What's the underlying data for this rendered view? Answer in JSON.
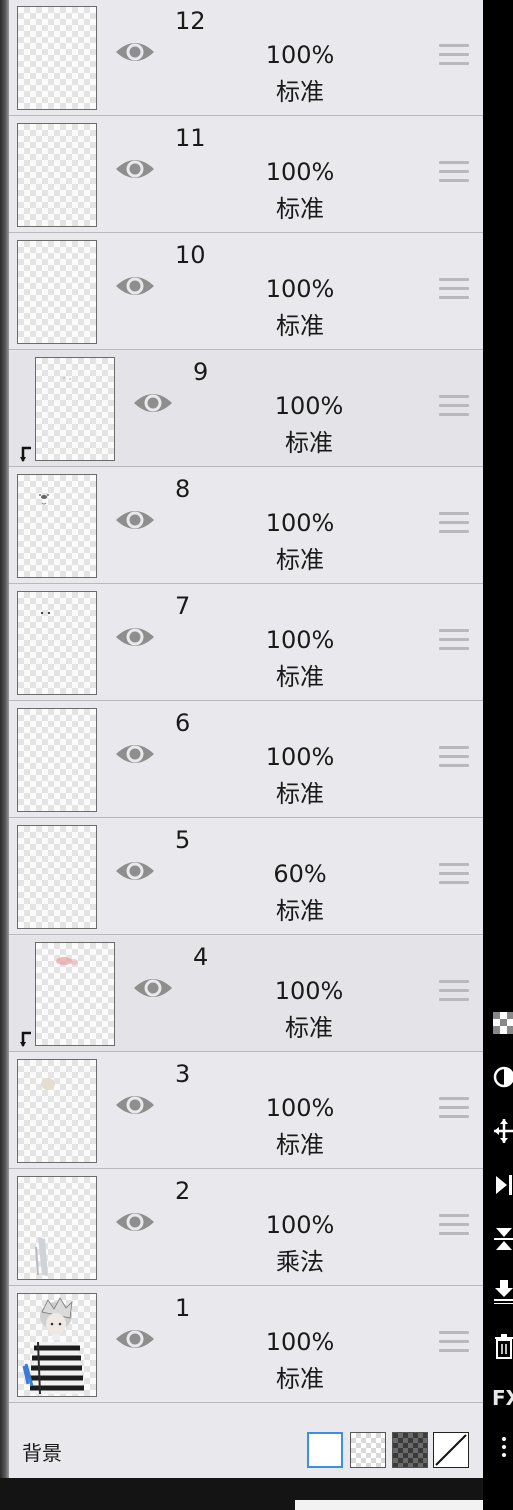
{
  "layers": [
    {
      "number": "12",
      "opacity": "100%",
      "blend": "标准",
      "clipped": false,
      "thumb": "empty"
    },
    {
      "number": "11",
      "opacity": "100%",
      "blend": "标准",
      "clipped": false,
      "thumb": "empty"
    },
    {
      "number": "10",
      "opacity": "100%",
      "blend": "标准",
      "clipped": false,
      "thumb": "empty"
    },
    {
      "number": "9",
      "opacity": "100%",
      "blend": "标准",
      "clipped": true,
      "thumb": "faint-dots"
    },
    {
      "number": "8",
      "opacity": "100%",
      "blend": "标准",
      "clipped": false,
      "thumb": "face-marks"
    },
    {
      "number": "7",
      "opacity": "100%",
      "blend": "标准",
      "clipped": false,
      "thumb": "eye-dots"
    },
    {
      "number": "6",
      "opacity": "100%",
      "blend": "标准",
      "clipped": false,
      "thumb": "empty"
    },
    {
      "number": "5",
      "opacity": "60%",
      "blend": "标准",
      "clipped": false,
      "thumb": "empty"
    },
    {
      "number": "4",
      "opacity": "100%",
      "blend": "标准",
      "clipped": true,
      "thumb": "blush"
    },
    {
      "number": "3",
      "opacity": "100%",
      "blend": "标准",
      "clipped": false,
      "thumb": "skin-patch"
    },
    {
      "number": "2",
      "opacity": "100%",
      "blend": "乘法",
      "clipped": false,
      "thumb": "shading"
    },
    {
      "number": "1",
      "opacity": "100%",
      "blend": "标准",
      "clipped": false,
      "thumb": "character"
    }
  ],
  "background": {
    "label": "背景",
    "options": [
      "white",
      "checker",
      "dark-checker",
      "none"
    ],
    "selected": "white"
  },
  "toolbar": {
    "icons": [
      "transparency-icon",
      "fill-icon",
      "move-icon",
      "merge-down-icon",
      "flatten-icon",
      "export-icon",
      "trash-icon"
    ],
    "fx_label": "FX"
  },
  "colors": {
    "panel": "#e9e8ec",
    "selected_accent": "#3d8fe3",
    "eye": "#8e8e8e"
  }
}
